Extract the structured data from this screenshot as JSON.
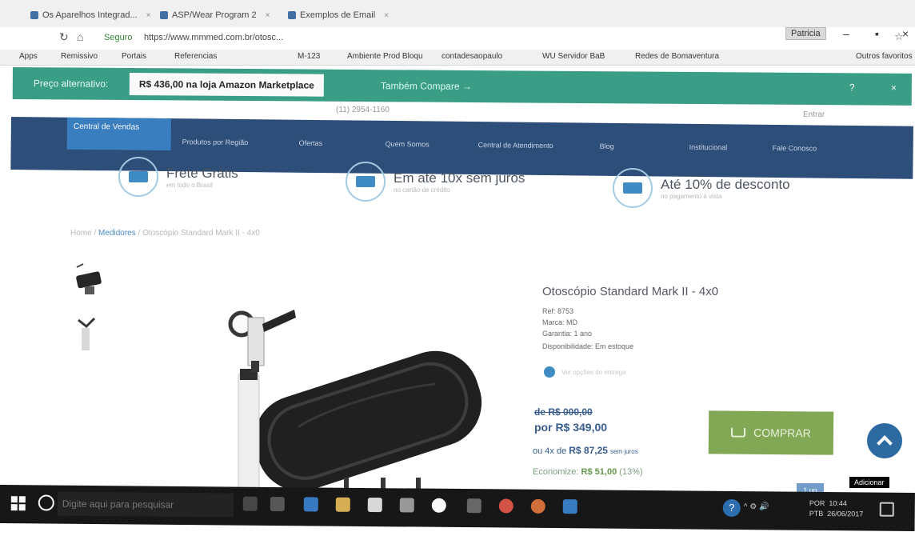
{
  "browser": {
    "tabs": [
      {
        "label": "Os Aparelhos Integrad..."
      },
      {
        "label": "ASP/Wear Program 2"
      },
      {
        "label": "Exemplos de Email"
      }
    ],
    "user_label": "Patricia",
    "secure_label": "Seguro",
    "url": "https://www.mmmed.com.br/otosc...",
    "bookmarks": [
      "Apps",
      "Remissivo",
      "Portais",
      "Referencias",
      "M-123",
      "Ambiente Prod Bloqu",
      "contadesaopaulo",
      "WU Servidor BaB",
      "Redes de Bomaventura",
      "Outros favoritos"
    ]
  },
  "banner": {
    "label": "Preço alternativo:",
    "price_text": "R$ 436,00 na loja Amazon Marketplace",
    "compare_label": "Também Compare →",
    "help": "?",
    "close": "×"
  },
  "store": {
    "contact": "(11) 2954-1160",
    "login": "Entrar",
    "nav": {
      "home": "Central de Vendas",
      "items": [
        "Produtos por Região",
        "Ofertas",
        "Quem Somos",
        "Central de Atendimento",
        "Blog",
        "Institucional",
        "Fale Conosco"
      ]
    },
    "benefits": [
      {
        "title": "Frete Grátis",
        "subtitle": "em todo o Brasil"
      },
      {
        "title": "Em até 10x sem juros",
        "subtitle": "no cartão de crédito"
      },
      {
        "title": "Até 10% de desconto",
        "subtitle": "no pagamento à vista"
      }
    ],
    "breadcrumb": {
      "home": "Home",
      "separator": "/",
      "category": "Medidores",
      "product": "Otoscópio Standard Mark II - 4x0"
    }
  },
  "product": {
    "name": "Otoscópio Standard Mark II - 4x0",
    "meta": [
      "Ref: 8753",
      "Marca: MD",
      "Garantia: 1 ano",
      "Disponibilidade: Em estoque"
    ],
    "info_text": "Ver opções de entrega",
    "old_price": "de R$ 000,00",
    "new_price": "por R$ 349,00",
    "installments": {
      "prefix": "ou 4x de",
      "value": "R$ 87,25",
      "suffix": "sem juros"
    },
    "economy": {
      "label": "Economize:",
      "value": "R$ 51,00",
      "percent": "(13%)"
    },
    "buy_label": "COMPRAR",
    "qty_label": "1 un",
    "tooltip": "Adicionar"
  },
  "taskbar": {
    "search_placeholder": "Digite aqui para pesquisar",
    "tray": "^ ⚙ 🔊",
    "language": "POR",
    "language_sub": "PTB",
    "time": "10:44",
    "date": "26/06/2017"
  },
  "colors": {
    "banner_green": "#28a487",
    "nav_blue": "#234c80",
    "buy_green": "#7fad46",
    "price_blue": "#2d5c9a"
  }
}
